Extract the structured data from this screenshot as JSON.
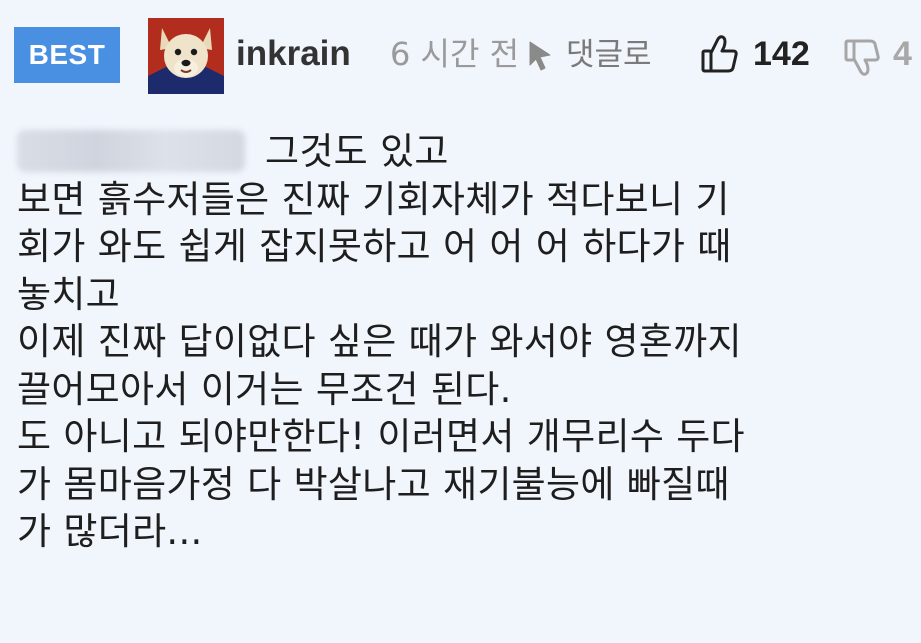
{
  "header": {
    "badge": "BEST",
    "username": "inkrain",
    "time_ago": "6 시간 전",
    "reply_label": "댓글로",
    "like_count": "142",
    "dislike_count": "4"
  },
  "icons": {
    "avatar": "dog-avatar",
    "reply": "reply-arrow-icon",
    "like": "thumbs-up-icon",
    "dislike": "thumbs-down-icon"
  },
  "colors": {
    "background": "#f1f5fc",
    "badge": "#4a90e2",
    "muted_text": "#9a9a9a"
  },
  "comment": {
    "mention_blurred": true,
    "lines": [
      "그것도 있고",
      "보면 흙수저들은 진짜 기회자체가 적다보니 기",
      "회가 와도 쉽게 잡지못하고 어 어 어 하다가 때",
      "놓치고",
      "이제 진짜 답이없다 싶은 때가 와서야 영혼까지",
      "끌어모아서 이거는 무조건 된다.",
      "도 아니고 되야만한다! 이러면서 개무리수 두다",
      "가 몸마음가정 다 박살나고 재기불능에 빠질때",
      "가 많더라..."
    ]
  }
}
